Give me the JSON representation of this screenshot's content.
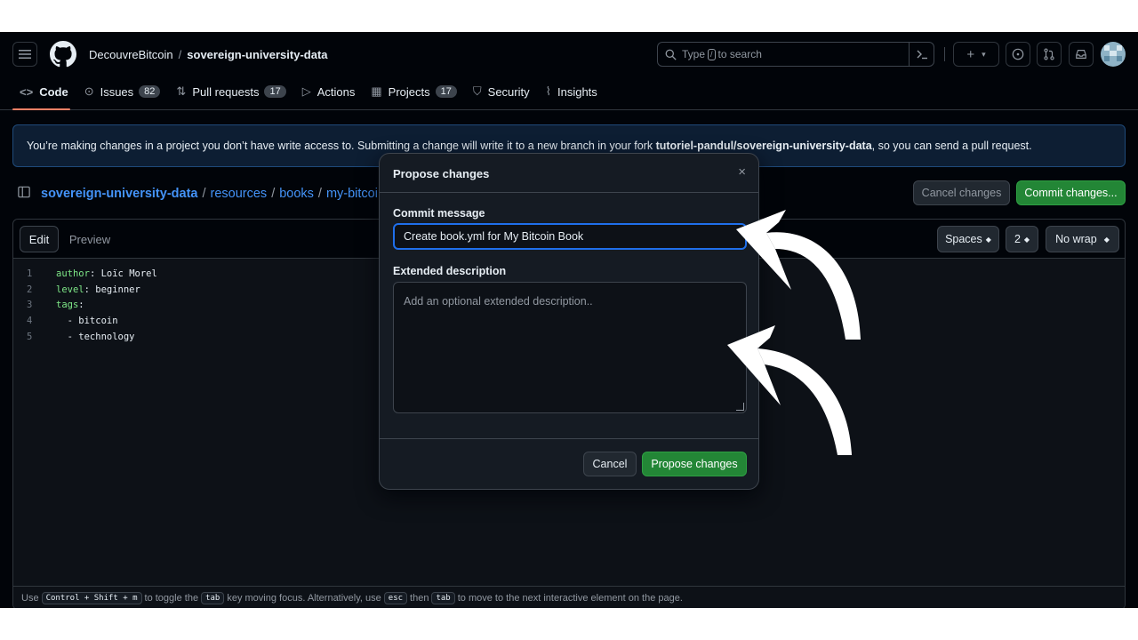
{
  "header": {
    "owner": "DecouvreBitcoin",
    "separator": "/",
    "repo": "sovereign-university-data",
    "search_before": "Type",
    "search_key": "/",
    "search_after": "to search",
    "plus": "+",
    "plus_caret": "▾"
  },
  "tabs": [
    {
      "icon": "<>",
      "label": "Code",
      "count": ""
    },
    {
      "icon": "⊙",
      "label": "Issues",
      "count": "82"
    },
    {
      "icon": "⇅",
      "label": "Pull requests",
      "count": "17"
    },
    {
      "icon": "▷",
      "label": "Actions",
      "count": ""
    },
    {
      "icon": "▦",
      "label": "Projects",
      "count": "17"
    },
    {
      "icon": "⛉",
      "label": "Security",
      "count": ""
    },
    {
      "icon": "⌇",
      "label": "Insights",
      "count": ""
    }
  ],
  "banner": {
    "text_before": "You’re making changes in a project you don’t have write access to. Submitting a change will write it to a new branch in your fork ",
    "fork": "tutoriel-pandul/sovereign-university-data",
    "text_after": ", so you can send a pull request."
  },
  "path": {
    "root": "sovereign-university-data",
    "sep": "/",
    "seg1": "resources",
    "seg2": "books",
    "seg3": "my-bitcoin-"
  },
  "actions": {
    "cancel": "Cancel changes",
    "commit": "Commit changes..."
  },
  "editor": {
    "tab_edit": "Edit",
    "tab_preview": "Preview",
    "indent_mode": "Spaces",
    "indent_size": "2",
    "wrap_mode": "No wrap",
    "lines": [
      {
        "num": "1",
        "key": "author",
        "value": ": Loïc Morel"
      },
      {
        "num": "2",
        "key": "level",
        "value": ": beginner"
      },
      {
        "num": "3",
        "key": "tags",
        "value": ":"
      },
      {
        "num": "4",
        "key": "",
        "value": "  - bitcoin"
      },
      {
        "num": "5",
        "key": "",
        "value": "  - technology"
      }
    ],
    "footer": {
      "use": "Use",
      "keys": "Control + Shift + m",
      "mid1": "to toggle the",
      "tab_key": "tab",
      "mid2": "key moving focus. Alternatively, use",
      "esc_key": "esc",
      "then": "then",
      "tab_key2": "tab",
      "end": "to move to the next interactive element on the page."
    }
  },
  "modal": {
    "title": "Propose changes",
    "close": "×",
    "commit_label": "Commit message",
    "commit_value": "Create book.yml for My Bitcoin Book",
    "desc_label": "Extended description",
    "desc_placeholder": "Add an optional extended description..",
    "cancel": "Cancel",
    "submit": "Propose changes"
  },
  "colors": {
    "accent_green": "#238636",
    "focus_blue": "#1f6feb",
    "link_blue": "#4493f8",
    "active_tab_underline": "#f78166"
  }
}
